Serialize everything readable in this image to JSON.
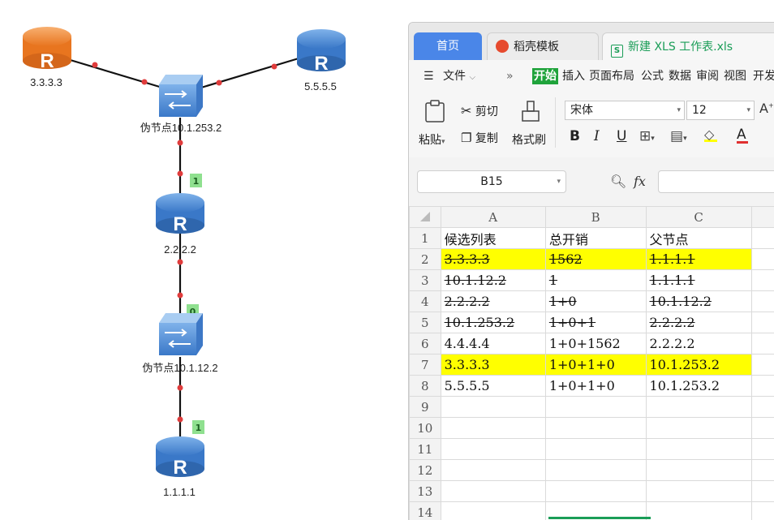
{
  "topology": {
    "nodes": [
      {
        "id": "r3",
        "type": "router",
        "color": "orange",
        "label": "3.3.3.3"
      },
      {
        "id": "r5",
        "type": "router",
        "color": "blue",
        "label": "5.5.5.5"
      },
      {
        "id": "pn1",
        "type": "switch",
        "label": "伪节点10.1.253.2"
      },
      {
        "id": "r2",
        "type": "router",
        "color": "blue",
        "label": "2.2.2.2"
      },
      {
        "id": "pn2",
        "type": "switch",
        "label": "伪节点10.1.12.2"
      },
      {
        "id": "r1",
        "type": "router",
        "color": "blue",
        "label": "1.1.1.1"
      }
    ],
    "link_costs": [
      "1",
      "0",
      "1"
    ],
    "router_glyph": "R"
  },
  "window": {
    "tabs": [
      {
        "label": "首页"
      },
      {
        "label": "稻壳模板"
      },
      {
        "label": "新建 XLS 工作表.xls"
      }
    ],
    "file_icon_letter": "S",
    "menu": {
      "file": "文件",
      "more": "»",
      "items": [
        "开始",
        "插入",
        "页面布局",
        "公式",
        "数据",
        "审阅",
        "视图",
        "开发"
      ]
    },
    "ribbon": {
      "paste": "粘贴",
      "cut": "剪切",
      "copy": "复制",
      "format_painter": "格式刷",
      "font_name": "宋体",
      "font_size": "12",
      "bold": "B",
      "italic": "I",
      "underline": "U",
      "font_color_letter": "A"
    },
    "formula_bar": {
      "cell_ref": "B15",
      "fx": "fx"
    }
  },
  "sheet": {
    "columns": [
      "A",
      "B",
      "C"
    ],
    "selected_column": "B",
    "highlight_color": "#ffff00",
    "rows": [
      {
        "n": "1",
        "cells": [
          "候选列表",
          "总开销",
          "父节点"
        ],
        "strike": false,
        "highlight": false
      },
      {
        "n": "2",
        "cells": [
          "3.3.3.3",
          "1562",
          "1.1.1.1"
        ],
        "strike": true,
        "highlight": true
      },
      {
        "n": "3",
        "cells": [
          "10.1.12.2",
          "1",
          "1.1.1.1"
        ],
        "strike": true,
        "highlight": false
      },
      {
        "n": "4",
        "cells": [
          "2.2.2.2",
          "1+0",
          "10.1.12.2"
        ],
        "strike": true,
        "highlight": false
      },
      {
        "n": "5",
        "cells": [
          "10.1.253.2",
          "1+0+1",
          "2.2.2.2"
        ],
        "strike": true,
        "highlight": false
      },
      {
        "n": "6",
        "cells": [
          "4.4.4.4",
          "1+0+1562",
          "2.2.2.2"
        ],
        "strike": false,
        "highlight": false
      },
      {
        "n": "7",
        "cells": [
          "3.3.3.3",
          "1+0+1+0",
          "10.1.253.2"
        ],
        "strike": false,
        "highlight": true
      },
      {
        "n": "8",
        "cells": [
          "5.5.5.5",
          "1+0+1+0",
          "10.1.253.2"
        ],
        "strike": false,
        "highlight": false
      },
      {
        "n": "9",
        "cells": [
          "",
          "",
          ""
        ],
        "strike": false,
        "highlight": false
      },
      {
        "n": "10",
        "cells": [
          "",
          "",
          ""
        ],
        "strike": false,
        "highlight": false
      },
      {
        "n": "11",
        "cells": [
          "",
          "",
          ""
        ],
        "strike": false,
        "highlight": false
      },
      {
        "n": "12",
        "cells": [
          "",
          "",
          ""
        ],
        "strike": false,
        "highlight": false
      },
      {
        "n": "13",
        "cells": [
          "",
          "",
          ""
        ],
        "strike": false,
        "highlight": false
      },
      {
        "n": "14",
        "cells": [
          "",
          "",
          ""
        ],
        "strike": false,
        "highlight": false
      }
    ]
  }
}
